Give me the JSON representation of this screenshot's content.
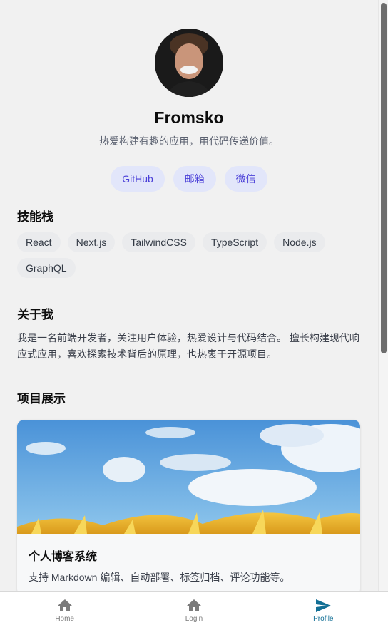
{
  "profile": {
    "name": "Fromsko",
    "tagline": "热爱构建有趣的应用，用代码传递价值。",
    "links": [
      "GitHub",
      "邮箱",
      "微信"
    ]
  },
  "skills": {
    "title": "技能栈",
    "items": [
      "React",
      "Next.js",
      "TailwindCSS",
      "TypeScript",
      "Node.js",
      "GraphQL"
    ]
  },
  "about": {
    "title": "关于我",
    "text": "我是一名前端开发者，关注用户体验，热爱设计与代码结合。 擅长构建现代响应式应用，喜欢探索技术背后的原理，也热衷于开源项目。"
  },
  "projects": {
    "title": "项目展示",
    "items": [
      {
        "title": "个人博客系统",
        "desc": "支持 Markdown 编辑、自动部署、标签归档、评论功能等。"
      }
    ]
  },
  "nav": {
    "items": [
      {
        "label": "Home",
        "icon": "home-icon"
      },
      {
        "label": "Login",
        "icon": "home-icon"
      },
      {
        "label": "Profile",
        "icon": "send-icon"
      }
    ],
    "active": "Profile",
    "active_color": "#126f95"
  }
}
